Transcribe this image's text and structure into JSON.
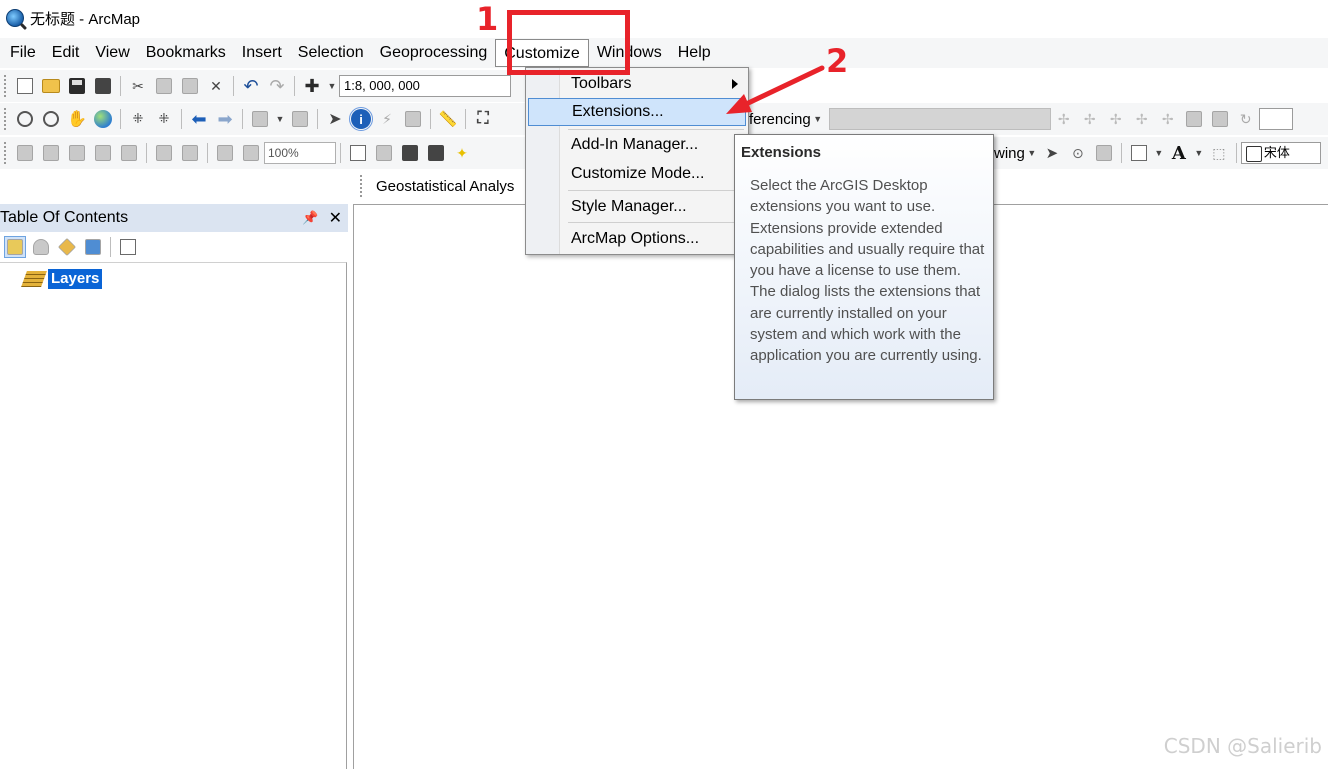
{
  "window": {
    "title": "无标题 - ArcMap"
  },
  "menu": [
    "File",
    "Edit",
    "View",
    "Bookmarks",
    "Insert",
    "Selection",
    "Geoprocessing",
    "Customize",
    "Windows",
    "Help"
  ],
  "toolbar": {
    "scale_value": "1:8, 000, 000",
    "zoom_value": "100%",
    "georef_label": "ferencing",
    "drawing_label": "wing",
    "font_value": "宋体",
    "text_tool_label": "A",
    "geostat_label": "Geostatistical Analys"
  },
  "customize_menu": {
    "items": [
      "Toolbars",
      "Extensions...",
      "Add-In Manager...",
      "Customize Mode...",
      "Style Manager...",
      "ArcMap Options..."
    ],
    "highlighted": "Extensions..."
  },
  "tooltip": {
    "title": "Extensions",
    "body": "Select the ArcGIS Desktop extensions you want to use. Extensions provide extended capabilities and usually require that you have a license to use them. The dialog lists the extensions that are currently installed on your system and which work with the application you are currently using."
  },
  "toc": {
    "title": "Table Of Contents",
    "pin_icon": "pin-icon",
    "close_icon": "close-icon",
    "layers_label": "Layers"
  },
  "annotations": {
    "step1": "1",
    "step2": "2",
    "color": "#e8232a"
  },
  "watermark": "CSDN @Salierib"
}
